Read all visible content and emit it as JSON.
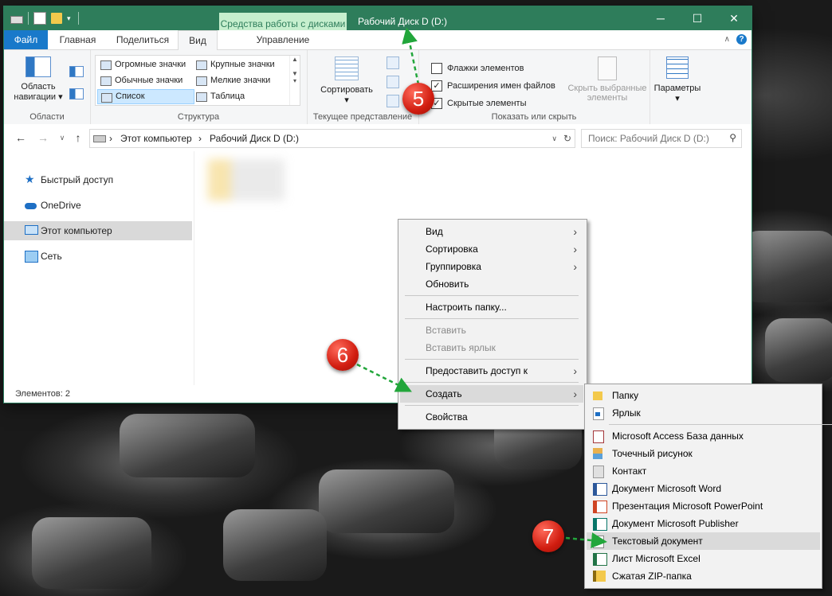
{
  "window": {
    "title": "Рабочий Диск D (D:)",
    "context_tab_label": "Средства работы с дисками"
  },
  "tabs": [
    {
      "label": "Файл"
    },
    {
      "label": "Главная"
    },
    {
      "label": "Поделиться"
    },
    {
      "label": "Вид"
    },
    {
      "label": "Управление"
    }
  ],
  "ribbon": {
    "areas": {
      "nav_pane_label": "Область навигации",
      "group_label": "Области"
    },
    "structure": {
      "group_label": "Структура",
      "layouts": [
        "Огромные значки",
        "Крупные значки",
        "Обычные значки",
        "Мелкие значки",
        "Список",
        "Таблица"
      ],
      "selected": "Список"
    },
    "current_view": {
      "sort_label": "Сортировать",
      "group_label": "Текущее представление"
    },
    "show_hide": {
      "group_label": "Показать или скрыть",
      "checkboxes": [
        {
          "label": "Флажки элементов",
          "checked": false
        },
        {
          "label": "Расширения имен файлов",
          "checked": true
        },
        {
          "label": "Скрытые элементы",
          "checked": true
        }
      ],
      "hide_selected_label": "Скрыть выбранные элементы"
    },
    "params": {
      "label": "Параметры"
    }
  },
  "address": {
    "crumbs": [
      "Этот компьютер",
      "Рабочий Диск D (D:)"
    ],
    "search_placeholder": "Поиск: Рабочий Диск D (D:)"
  },
  "nav_pane": [
    {
      "label": "Быстрый доступ",
      "icon": "star-icon",
      "selected": false
    },
    {
      "label": "OneDrive",
      "icon": "cloud-icon",
      "selected": false
    },
    {
      "label": "Этот компьютер",
      "icon": "computer-icon",
      "selected": true
    },
    {
      "label": "Сеть",
      "icon": "network-icon",
      "selected": false
    }
  ],
  "status": {
    "items_count": "Элементов: 2"
  },
  "context_menu": {
    "items": [
      {
        "label": "Вид",
        "submenu": true
      },
      {
        "label": "Сортировка",
        "submenu": true
      },
      {
        "label": "Группировка",
        "submenu": true
      },
      {
        "label": "Обновить"
      },
      {
        "label": "Настроить папку..."
      },
      {
        "label": "Вставить",
        "disabled": true
      },
      {
        "label": "Вставить ярлык",
        "disabled": true
      },
      {
        "label": "Предоставить доступ к",
        "submenu": true
      },
      {
        "label": "Создать",
        "submenu": true,
        "highlighted": true
      },
      {
        "label": "Свойства"
      }
    ]
  },
  "create_submenu": {
    "items": [
      {
        "label": "Папку",
        "icon": "folder-icon"
      },
      {
        "label": "Ярлык",
        "icon": "shortcut-icon"
      },
      {
        "label": "Microsoft Access База данных",
        "icon": "access-icon"
      },
      {
        "label": "Точечный рисунок",
        "icon": "bitmap-icon"
      },
      {
        "label": "Контакт",
        "icon": "contact-icon"
      },
      {
        "label": "Документ Microsoft Word",
        "icon": "word-icon"
      },
      {
        "label": "Презентация Microsoft PowerPoint",
        "icon": "powerpoint-icon"
      },
      {
        "label": "Документ Microsoft Publisher",
        "icon": "publisher-icon"
      },
      {
        "label": "Текстовый документ",
        "icon": "text-document-icon",
        "highlighted": true
      },
      {
        "label": "Лист Microsoft Excel",
        "icon": "excel-icon"
      },
      {
        "label": "Сжатая ZIP-папка",
        "icon": "zip-icon"
      }
    ]
  },
  "badges": [
    "5",
    "6",
    "7"
  ],
  "colors": {
    "titlebar": "#2e7d5b",
    "file_tab": "#1979ca",
    "badge": "#d11d10",
    "arrow": "#22a63b"
  }
}
